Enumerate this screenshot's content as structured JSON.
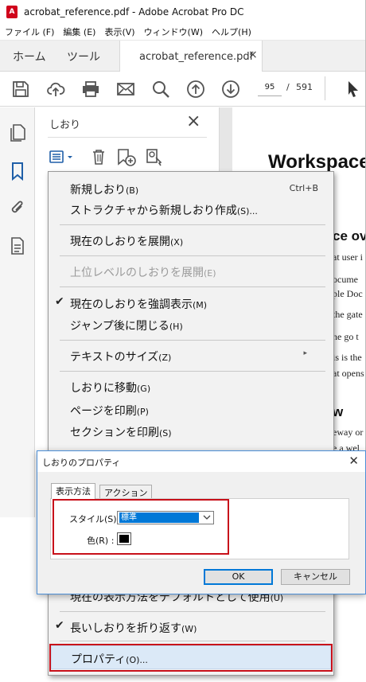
{
  "window": {
    "title": "acrobat_reference.pdf - Adobe Acrobat Pro DC",
    "app_icon_letter": "A",
    "menus": [
      "ファイル (F)",
      "編集 (E)",
      "表示(V)",
      "ウィンドウ(W)",
      "ヘルプ(H)"
    ]
  },
  "tabs": {
    "home": "ホーム",
    "tools": "ツール",
    "doc": "acrobat_reference.pdf",
    "close": "×"
  },
  "toolbar": {
    "icons": [
      "save-icon",
      "cloud-upload-icon",
      "print-icon",
      "mail-icon",
      "search-icon",
      "page-up-icon",
      "page-down-icon",
      "select-cursor-icon"
    ],
    "page_current": "95",
    "page_sep": "/",
    "page_total": "591"
  },
  "rail": {
    "icons": [
      "pages-icon",
      "bookmark-icon",
      "attachment-icon",
      "document-icon"
    ]
  },
  "bookmarks_panel": {
    "title": "しおり",
    "close": "×",
    "tool_icons": [
      "options-menu-icon",
      "trash-icon",
      "new-bookmark-icon",
      "bookmark-search-icon"
    ]
  },
  "document": {
    "heading": "Workspace",
    "sub1": "ce ov",
    "sub2": "w",
    "lines": [
      "at user i",
      "ocume",
      "ple Doc",
      "the gate",
      "he go t",
      "is is the",
      "at opens",
      "eway or",
      "e a wel"
    ]
  },
  "context_menu": {
    "items": [
      {
        "label": "新規しおり",
        "accel": "(B)",
        "shortcut": "Ctrl+B"
      },
      {
        "label": "ストラクチャから新規しおり作成",
        "accel": "(S)..."
      },
      {
        "label": "現在のしおりを展開",
        "accel": "(X)"
      },
      {
        "label": "上位レベルのしおりを展開",
        "accel": "(E)",
        "disabled": true
      },
      {
        "label": "現在のしおりを強調表示",
        "accel": "(M)",
        "checked": true
      },
      {
        "label": "ジャンプ後に閉じる",
        "accel": "(H)"
      },
      {
        "label": "テキストのサイズ",
        "accel": "(Z)",
        "submenu": true
      },
      {
        "label": "しおりに移動",
        "accel": "(G)"
      },
      {
        "label": "ページを印刷",
        "accel": "(P)"
      },
      {
        "label": "セクションを印刷",
        "accel": "(S)"
      },
      {
        "label": "現在の表示方法をデフォルトとして使用",
        "accel": "(U)"
      },
      {
        "label": "長いしおりを折り返す",
        "accel": "(W)",
        "checked": true
      },
      {
        "label": "プロパティ",
        "accel": "(O)..."
      }
    ],
    "check_glyph": "✔",
    "submenu_glyph": "▸"
  },
  "dialog": {
    "title": "しおりのプロパティ",
    "close": "✕",
    "tabs": [
      "表示方法",
      "アクション"
    ],
    "style_label": "スタイル(S) :",
    "style_value": "標準",
    "color_label": "色(R) :",
    "color_value": "#000000",
    "ok": "OK",
    "cancel": "キャンセル"
  },
  "colors": {
    "highlight_red": "#c8101a",
    "selection_blue": "#0078d7",
    "acrobat_red": "#d0021b",
    "icon_blue": "#1f5fa8"
  }
}
